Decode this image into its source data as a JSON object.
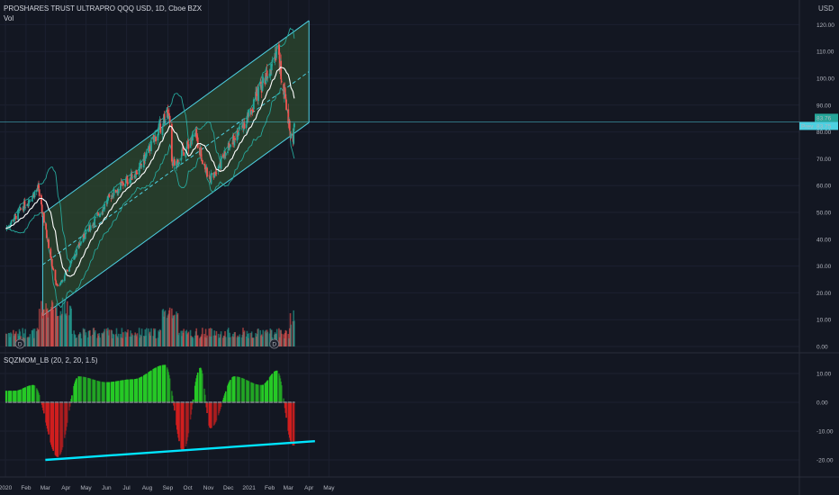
{
  "header": {
    "symbol_title": "PROSHARES TRUST ULTRAPRO QQQ USD, 1D, Cboe BZX",
    "volume_label": "Vol",
    "indicator_label": "SQZMOM_LB (20, 2, 20, 1.5)",
    "currency": "USD"
  },
  "price_axis": {
    "ticks": [
      "120.00",
      "110.00",
      "100.00",
      "90.00",
      "80.00",
      "70.00",
      "60.00",
      "50.00",
      "40.00",
      "30.00",
      "20.00",
      "10.00",
      "0.00"
    ],
    "last_price": "83.76",
    "prev_label": "Prev",
    "prev_price": "83.75"
  },
  "indicator_axis": {
    "ticks": [
      "10.00",
      "0.00",
      "-10.00",
      "-20.00"
    ]
  },
  "time_axis": {
    "ticks": [
      "2020",
      "Feb",
      "Mar",
      "Apr",
      "May",
      "Jun",
      "Jul",
      "Aug",
      "Sep",
      "Oct",
      "Nov",
      "Dec",
      "2021",
      "Feb",
      "Mar",
      "Apr",
      "May"
    ]
  },
  "markers": [
    "D",
    "D"
  ],
  "colors": {
    "background": "#131722",
    "up": "#26a69a",
    "down": "#ef5350",
    "channel": "#4dd0e1",
    "channel_fill": "#2e4a2f",
    "bollinger": "#26a69a",
    "sma": "#ffffff",
    "squeeze_up": "#26c926",
    "squeeze_down": "#d01f1f",
    "trendline": "#00e5ff"
  },
  "chart_data": {
    "type": "line",
    "title": "PROSHARES TRUST ULTRAPRO QQQ USD, 1D, Cboe BZX",
    "price_key_points": [
      {
        "date": "2020-01-02",
        "close": 44
      },
      {
        "date": "2020-02-19",
        "close": 59
      },
      {
        "date": "2020-03-16",
        "close": 24
      },
      {
        "date": "2020-03-20",
        "close": 22
      },
      {
        "date": "2020-04-30",
        "close": 42
      },
      {
        "date": "2020-06-10",
        "close": 57
      },
      {
        "date": "2020-07-20",
        "close": 66
      },
      {
        "date": "2020-09-02",
        "close": 88
      },
      {
        "date": "2020-09-08",
        "close": 67
      },
      {
        "date": "2020-10-12",
        "close": 79
      },
      {
        "date": "2020-11-02",
        "close": 62
      },
      {
        "date": "2020-12-31",
        "close": 86
      },
      {
        "date": "2021-02-12",
        "close": 111
      },
      {
        "date": "2021-03-04",
        "close": 80
      },
      {
        "date": "2021-03-08",
        "close": 75
      },
      {
        "date": "2021-03-10",
        "close": 83.76
      }
    ],
    "squeeze_momentum_key_points": [
      {
        "date": "2020-01-15",
        "value": 4
      },
      {
        "date": "2020-02-12",
        "value": 6
      },
      {
        "date": "2020-03-20",
        "value": -19
      },
      {
        "date": "2020-04-20",
        "value": 9
      },
      {
        "date": "2020-06-01",
        "value": 7
      },
      {
        "date": "2020-07-10",
        "value": 8
      },
      {
        "date": "2020-08-28",
        "value": 13
      },
      {
        "date": "2020-09-24",
        "value": -17
      },
      {
        "date": "2020-10-20",
        "value": 12
      },
      {
        "date": "2020-11-04",
        "value": -9
      },
      {
        "date": "2020-12-10",
        "value": 9
      },
      {
        "date": "2021-01-20",
        "value": 6
      },
      {
        "date": "2021-02-12",
        "value": 11
      },
      {
        "date": "2021-03-08",
        "value": -15
      }
    ],
    "ylim_price": [
      0,
      125
    ],
    "ylim_indicator": [
      -22,
      14
    ]
  }
}
